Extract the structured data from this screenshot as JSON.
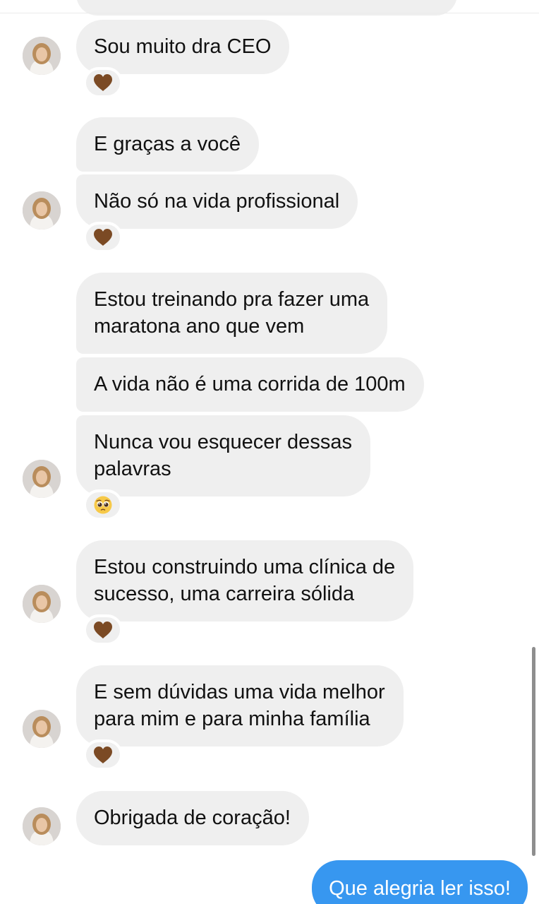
{
  "colors": {
    "received_bubble": "#efefef",
    "sent_bubble": "#3797f0",
    "heart_reaction": "#7b4a24",
    "scrollbar": "#8e8e8e"
  },
  "messages": [
    {
      "lines": [
        "Sou muito dra CEO"
      ],
      "reaction": "brown-heart"
    },
    {
      "lines": [
        "E graças a você"
      ]
    },
    {
      "lines": [
        "Não só na vida profissional"
      ],
      "reaction": "brown-heart"
    },
    {
      "lines": [
        "Estou treinando pra fazer uma",
        "maratona ano que vem"
      ]
    },
    {
      "lines": [
        "A vida não é uma corrida de 100m"
      ]
    },
    {
      "lines": [
        "Nunca vou esquecer dessas",
        "palavras"
      ],
      "reaction": "pleading-face"
    },
    {
      "lines": [
        "Estou construindo uma clínica de",
        "sucesso, uma carreira sólida"
      ],
      "reaction": "brown-heart"
    },
    {
      "lines": [
        "E sem dúvidas uma vida melhor",
        "para mim e para minha família"
      ],
      "reaction": "brown-heart"
    },
    {
      "lines": [
        "Obrigada de coração!"
      ]
    }
  ],
  "sent": {
    "text": "Que alegria ler isso!"
  }
}
